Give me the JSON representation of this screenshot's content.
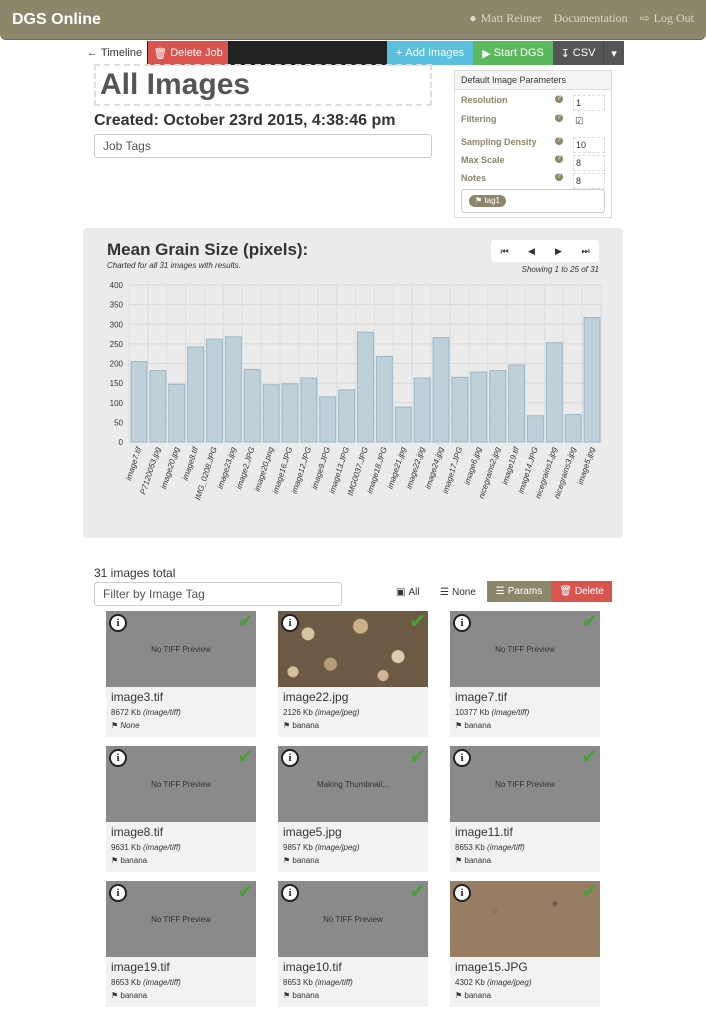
{
  "navbar": {
    "brand": "DGS Online",
    "user": "Matt Reimer",
    "docs": "Documentation",
    "logout": "Log Out"
  },
  "toolbar": {
    "timeline": "Timeline",
    "delete_job": "Delete Job",
    "add_images": "Add Images",
    "start_dgs": "Start DGS",
    "csv": "CSV"
  },
  "job": {
    "title": "All Images",
    "created_label": "Created:",
    "created_value": "October 23rd 2015, 4:38:46 pm",
    "tags_placeholder": "Job Tags"
  },
  "params": {
    "header": "Default Image Parameters",
    "rows": [
      {
        "label": "Resolution",
        "value": "1"
      },
      {
        "label": "Filtering",
        "value": "checked"
      },
      {
        "label": "Sampling Density",
        "value": "10"
      },
      {
        "label": "Max Scale",
        "value": "8"
      },
      {
        "label": "Notes",
        "value": "8"
      }
    ],
    "tag": "tag1"
  },
  "chart_panel": {
    "title": "Mean Grain Size (pixels):",
    "subtitle": "Charted for all 31 images with results.",
    "showing": "Showing 1 to 25 of 31"
  },
  "chart_data": {
    "type": "bar",
    "title": "Mean Grain Size (pixels):",
    "ylim": [
      0,
      400
    ],
    "yticks": [
      0,
      50,
      100,
      150,
      200,
      250,
      300,
      350,
      400
    ],
    "grid": true,
    "categories": [
      "image7.tif",
      "P7120053.jpg",
      "image20.jpg",
      "image8.tif",
      "IMG_0208.JPG",
      "image23.jpg",
      "image2.JPG",
      "image20.png",
      "image16.JPG",
      "image12.JPG",
      "image9.JPG",
      "image13.JPG",
      "IMG0037.JPG",
      "image18.JPG",
      "image21.jpg",
      "image22.jpg",
      "image24.jpg",
      "image17.JPG",
      "image6.jpg",
      "nicegrains2.jpg",
      "image19.tif",
      "image14.JPG",
      "nicegrains1.jpg",
      "nicegrains3.jpg",
      "image5.jpg"
    ],
    "values": [
      205,
      182,
      147,
      242,
      262,
      268,
      185,
      146,
      148,
      163,
      115,
      133,
      280,
      218,
      89,
      163,
      266,
      165,
      178,
      182,
      196,
      67,
      253,
      70,
      317
    ]
  },
  "list": {
    "total": "31 images total",
    "filter_placeholder": "Filter by Image Tag",
    "select_all": "All",
    "select_none": "None",
    "params_button": "Params",
    "delete_button": "Delete"
  },
  "cards": [
    {
      "name": "image3.tif",
      "size": "8672 Kb",
      "type": "(image/tiff)",
      "tag": "None",
      "preview": "No TIFF Preview",
      "thumb": "gray"
    },
    {
      "name": "image22.jpg",
      "size": "2126 Kb",
      "type": "(image/jpeg)",
      "tag": "banana",
      "preview": "",
      "thumb": "pebbles"
    },
    {
      "name": "image7.tif",
      "size": "10377 Kb",
      "type": "(image/tiff)",
      "tag": "banana",
      "preview": "No TIFF Preview",
      "thumb": "gray"
    },
    {
      "name": "image8.tif",
      "size": "9631 Kb",
      "type": "(image/tiff)",
      "tag": "banana",
      "preview": "No TIFF Preview",
      "thumb": "gray"
    },
    {
      "name": "image5.jpg",
      "size": "9857 Kb",
      "type": "(image/jpeg)",
      "tag": "banana",
      "preview": "Making Thumbnail...",
      "thumb": "gray"
    },
    {
      "name": "image11.tif",
      "size": "8653 Kb",
      "type": "(image/tiff)",
      "tag": "banana",
      "preview": "No TIFF Preview",
      "thumb": "gray"
    },
    {
      "name": "image19.tif",
      "size": "8653 Kb",
      "type": "(image/tiff)",
      "tag": "banana",
      "preview": "No TIFF Preview",
      "thumb": "gray"
    },
    {
      "name": "image10.tif",
      "size": "8653 Kb",
      "type": "(image/tiff)",
      "tag": "banana",
      "preview": "No TIFF Preview",
      "thumb": "gray"
    },
    {
      "name": "image15.JPG",
      "size": "4302 Kb",
      "type": "(image/jpeg)",
      "tag": "banana",
      "preview": "",
      "thumb": "sand"
    }
  ]
}
